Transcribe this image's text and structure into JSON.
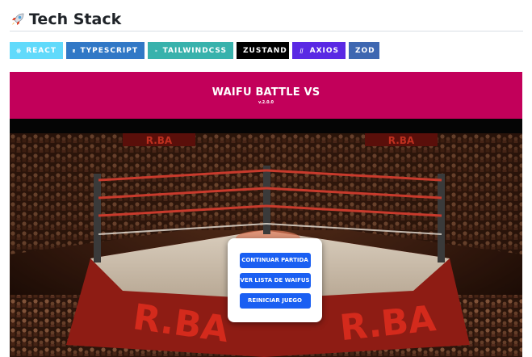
{
  "section": {
    "emoji_icon": "rocket-icon",
    "title": "Tech Stack"
  },
  "badges": [
    {
      "label": "REACT",
      "icon": "react-icon",
      "color": "#61dafb"
    },
    {
      "label": "TYPESCRIPT",
      "icon": "typescript-icon",
      "color": "#3178c6"
    },
    {
      "label": "TAILWINDCSS",
      "icon": "tailwind-icon",
      "color": "#38b2ac"
    },
    {
      "label": "ZUSTAND",
      "icon": null,
      "color": "#000000"
    },
    {
      "label": "AXIOS",
      "icon": "axios-icon",
      "color": "#5a29e4"
    },
    {
      "label": "ZOD",
      "icon": null,
      "color": "#3e67b1"
    }
  ],
  "screenshot": {
    "title": "WAIFU BATTLE VS",
    "version": "v.2.0.0",
    "banner_color": "#c2005a",
    "ring_logo": "R.BA",
    "menu": {
      "continue_label": "CONTINUAR PARTIDA",
      "list_label": "VER LISTA DE WAIFUS",
      "restart_label": "REINICIAR JUEGO",
      "button_color": "#1a5ff2"
    }
  }
}
